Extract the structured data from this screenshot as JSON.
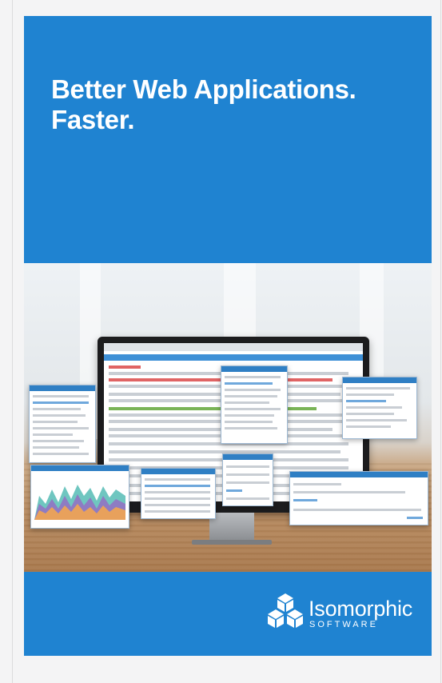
{
  "ad": {
    "headline_line1": "Better Web Applications.",
    "headline_line2": "Faster.",
    "background_color": "#1f83d1"
  },
  "brand": {
    "name": "Isomorphic",
    "tagline": "SOFTWARE",
    "logo_icon": "three-cube-cluster-icon"
  }
}
